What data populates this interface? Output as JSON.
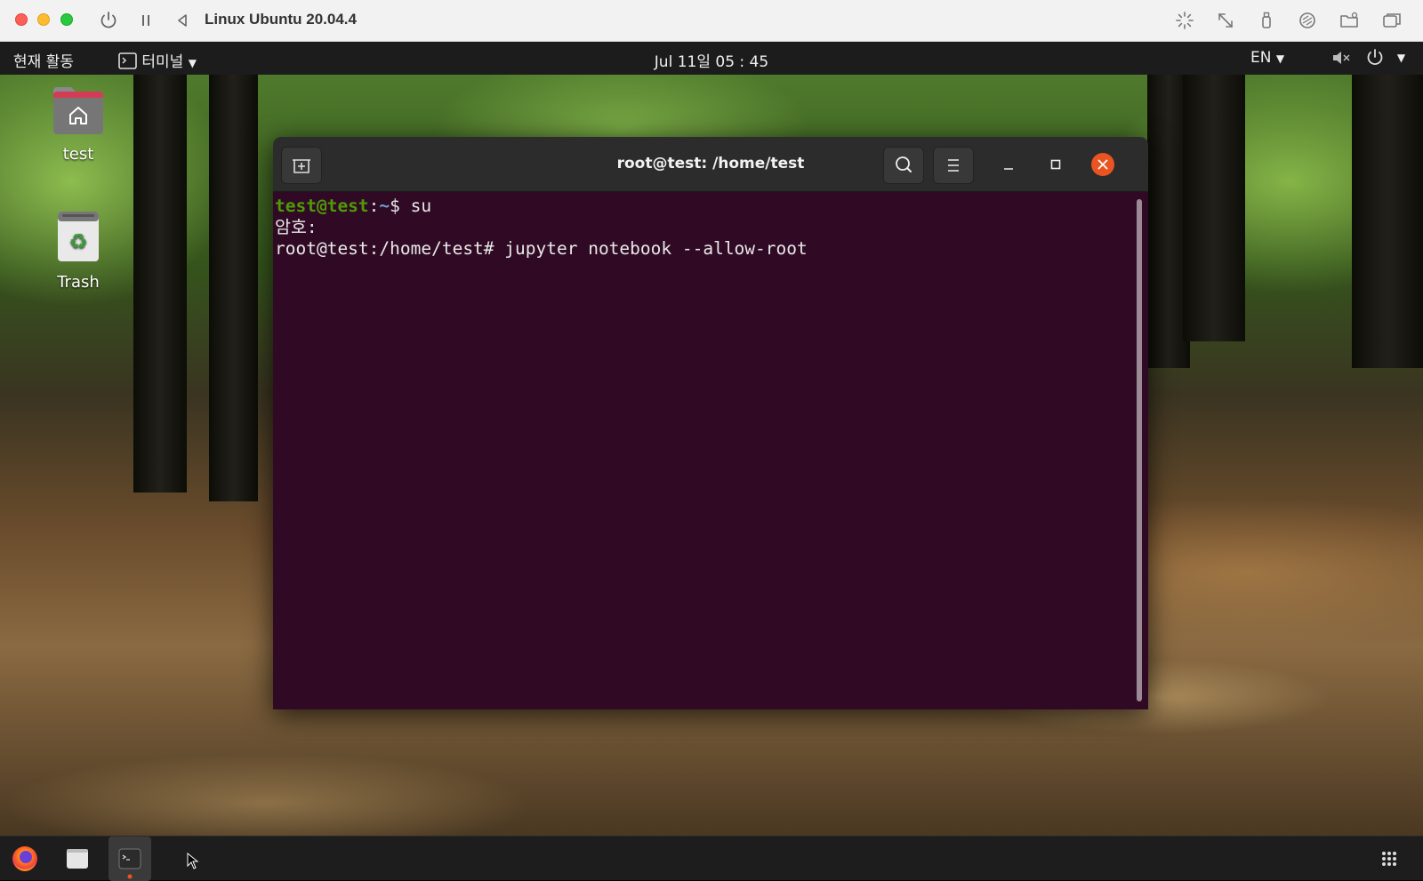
{
  "host": {
    "title": "Linux Ubuntu 20.04.4"
  },
  "topbar": {
    "activities": "현재 활동",
    "app_menu": "터미널",
    "clock": "Jul 11일  05 : 45",
    "input_lang": "EN"
  },
  "desktop": {
    "icons": [
      {
        "label": "test"
      },
      {
        "label": "Trash"
      }
    ]
  },
  "terminal": {
    "title": "root@test: /home/test",
    "line1": {
      "user": "test@test",
      "sep": ":",
      "path": "~",
      "rest": "$ su"
    },
    "line2": "암호:",
    "line3": "root@test:/home/test# jupyter notebook --allow-root"
  },
  "colors": {
    "terminal_bg": "#300a24",
    "prompt_user": "#4e9a06",
    "prompt_path": "#729fcf",
    "close_button": "#e95420"
  }
}
